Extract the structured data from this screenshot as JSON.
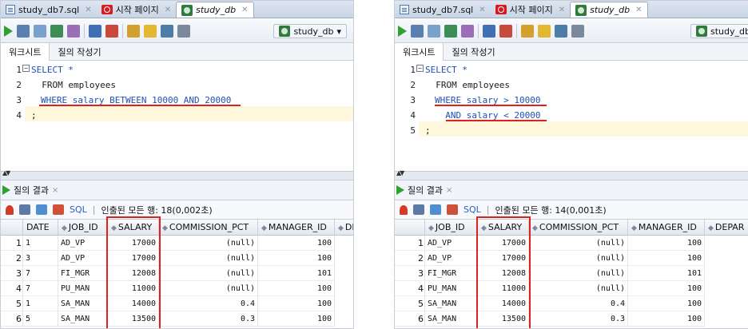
{
  "tabs": {
    "file": "study_db7.sql",
    "start": "시작 페이지",
    "db": "study_db"
  },
  "connection": "study_db",
  "subtabs": {
    "worksheet": "워크시트",
    "query_builder": "질의 작성기"
  },
  "results": {
    "tab_label": "질의 결과",
    "sql_label": "SQL",
    "separator": "|"
  },
  "colors": {
    "highlight_red": "#e0201b",
    "keyword_blue": "#1f4fb5"
  },
  "left": {
    "code": [
      {
        "n": "1",
        "text": "SELECT *"
      },
      {
        "n": "2",
        "text": "  FROM employees"
      },
      {
        "n": "3",
        "text": "WHERE salary BETWEEN 10000 AND 20000"
      },
      {
        "n": "4",
        "text": ";"
      }
    ],
    "status": "인출된 모든 행: 18(0,002초)",
    "headers": [
      "DATE",
      "JOB_ID",
      "SALARY",
      "COMMISSION_PCT",
      "MANAGER_ID",
      "DE"
    ],
    "rows": [
      [
        "1",
        "1",
        "AD_VP",
        "17000",
        "(null)",
        "100"
      ],
      [
        "2",
        "3",
        "AD_VP",
        "17000",
        "(null)",
        "100"
      ],
      [
        "3",
        "7",
        "FI_MGR",
        "12008",
        "(null)",
        "101"
      ],
      [
        "4",
        "7",
        "PU_MAN",
        "11000",
        "(null)",
        "100"
      ],
      [
        "5",
        "1",
        "SA_MAN",
        "14000",
        "0.4",
        "100"
      ],
      [
        "6",
        "5",
        "SA_MAN",
        "13500",
        "0.3",
        "100"
      ]
    ]
  },
  "right": {
    "code": [
      {
        "n": "1",
        "text": "SELECT *"
      },
      {
        "n": "2",
        "text": "  FROM employees"
      },
      {
        "n": "3",
        "text": "WHERE salary > 10000"
      },
      {
        "n": "4",
        "text": "  AND salary < 20000"
      },
      {
        "n": "5",
        "text": ";"
      }
    ],
    "status": "인출된 모든 행: 14(0,001초)",
    "headers": [
      "JOB_ID",
      "SALARY",
      "COMMISSION_PCT",
      "MANAGER_ID",
      "DEPAR"
    ],
    "rows": [
      [
        "1",
        "AD_VP",
        "17000",
        "(null)",
        "100"
      ],
      [
        "2",
        "AD_VP",
        "17000",
        "(null)",
        "100"
      ],
      [
        "3",
        "FI_MGR",
        "12008",
        "(null)",
        "101"
      ],
      [
        "4",
        "PU_MAN",
        "11000",
        "(null)",
        "100"
      ],
      [
        "5",
        "SA_MAN",
        "14000",
        "0.4",
        "100"
      ],
      [
        "6",
        "SA_MAN",
        "13500",
        "0.3",
        "100"
      ]
    ]
  }
}
